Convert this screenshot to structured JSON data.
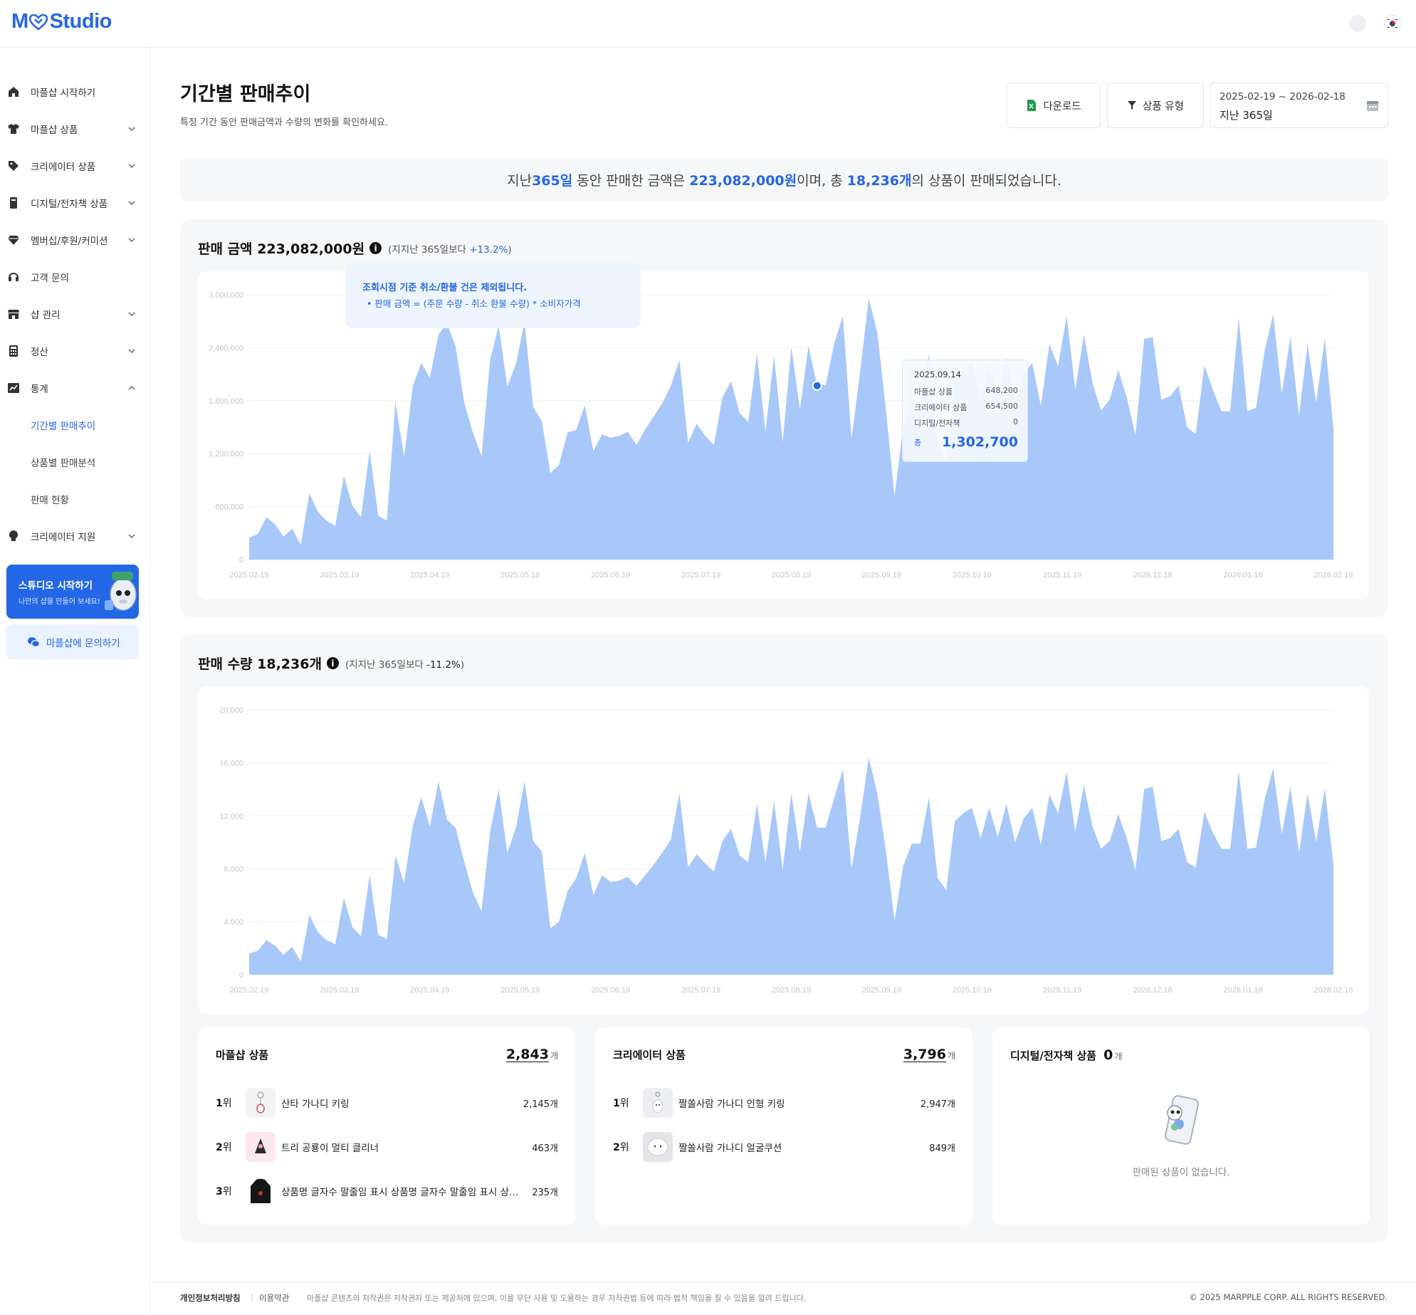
{
  "app": {
    "logo_prefix": "M",
    "logo_suffix": "Studio"
  },
  "sidebar": {
    "items": [
      {
        "label": "마플샵 시작하기",
        "icon": "home-icon"
      },
      {
        "label": "마플샵 상품",
        "icon": "tshirt-icon"
      },
      {
        "label": "크리에이터 상품",
        "icon": "tag-icon"
      },
      {
        "label": "디지털/전자책 상품",
        "icon": "book-icon"
      },
      {
        "label": "멤버십/후원/커미션",
        "icon": "diamond-icon"
      },
      {
        "label": "고객 문의",
        "icon": "headset-icon"
      },
      {
        "label": "샵 관리",
        "icon": "store-icon"
      },
      {
        "label": "정산",
        "icon": "calculator-icon"
      },
      {
        "label": "통계",
        "icon": "chart-icon"
      },
      {
        "label": "크리에이터 지원",
        "icon": "lightbulb-icon"
      }
    ],
    "stats_sub": [
      {
        "label": "기간별 판매추이",
        "active": true
      },
      {
        "label": "상품별 판매분석",
        "active": false
      },
      {
        "label": "판매 현황",
        "active": false
      }
    ],
    "promo_title": "스튜디오 시작하기",
    "promo_sub": "나만의 샵을 만들어 보세요!",
    "inquiry_label": "마플샵에 문의하기"
  },
  "header": {
    "title": "기간별 판매추이",
    "description": "특정 기간 동안 판매금액과 수량의 변화를 확인하세요.",
    "download_label": "다운로드",
    "type_label": "상품 유형",
    "date_range": "2025-02-19 ~ 2026-02-18",
    "date_label": "지난 365일"
  },
  "summary": {
    "p1": "지난 ",
    "days": "365일",
    "p2": " 동안 판매한 금액은 ",
    "amount": "223,082,000원",
    "p3": "이며, 총 ",
    "count": "18,236개",
    "p4": "의 상품이 판매되었습니다."
  },
  "amount_panel": {
    "title": "판매 금액 223,082,000원",
    "compare_prefix": "(지지난 365일보다 ",
    "compare_value": "+13.2%",
    "compare_suffix": ")",
    "notice_title": "조회시점 기준 취소/환불 건은 제외됩니다.",
    "notice_line": "•  판매 금액 = (주문 수량 - 취소 환불 수량) * 소비자가격"
  },
  "tooltip": {
    "date": "2025.09.14",
    "rows": [
      {
        "label": "마플샵 상품",
        "value": "648,200"
      },
      {
        "label": "크리에이터 상품",
        "value": "654,500"
      },
      {
        "label": "디지털/전자책",
        "value": "0"
      }
    ],
    "total_label": "총",
    "total_value": "1,302,700"
  },
  "qty_panel": {
    "title": "판매 수량 18,236개",
    "compare_prefix": "(지지난 365일보다 ",
    "compare_value": "-11.2%",
    "compare_suffix": ")"
  },
  "chart_data": [
    {
      "type": "area",
      "title": "판매 금액 223,082,000원",
      "x_ticks": [
        "2025.02.19",
        "2025.03.19",
        "2025.04.19",
        "2025.05.19",
        "2025.06.19",
        "2025.07.19",
        "2025.08.19",
        "2025.09.19",
        "2025.10.19",
        "2025.11.19",
        "2026.12.18",
        "2026.01.18",
        "2026.02.18"
      ],
      "y_ticks": [
        "3,000,000",
        "2,400,000",
        "1,800,000",
        "1,200,000",
        "600,000",
        "0"
      ],
      "ylim": [
        0,
        3000000
      ],
      "grid": true,
      "color": "#a8c8fa",
      "values": [
        250000,
        290000,
        480000,
        400000,
        260000,
        350000,
        170000,
        750000,
        540000,
        440000,
        380000,
        950000,
        610000,
        480000,
        1230000,
        500000,
        440000,
        1790000,
        1160000,
        1960000,
        2230000,
        2060000,
        2550000,
        2680000,
        2410000,
        1770000,
        1440000,
        1170000,
        2260000,
        2650000,
        1960000,
        2220000,
        2690000,
        1730000,
        1570000,
        980000,
        1070000,
        1440000,
        1470000,
        1750000,
        1230000,
        1420000,
        1380000,
        1400000,
        1450000,
        1300000,
        1470000,
        1620000,
        1770000,
        1970000,
        2260000,
        1320000,
        1540000,
        1400000,
        1300000,
        1840000,
        2020000,
        1660000,
        1560000,
        2330000,
        1450000,
        2310000,
        1330000,
        2410000,
        1700000,
        2420000,
        1970000,
        1980000,
        2450000,
        2760000,
        1370000,
        2130000,
        2960000,
        2570000,
        1690000,
        720000,
        1500000,
        1800000,
        1800000,
        2330000,
        1300000,
        1110000,
        2040000,
        2150000,
        2230000,
        1840000,
        2230000,
        1850000,
        2290000,
        1800000,
        2100000,
        2230000,
        1740000,
        2440000,
        2190000,
        2760000,
        1920000,
        2550000,
        2000000,
        1690000,
        1810000,
        2150000,
        1830000,
        1410000,
        2500000,
        2520000,
        1810000,
        1850000,
        1970000,
        1500000,
        1420000,
        2200000,
        1920000,
        1680000,
        1680000,
        2740000,
        1680000,
        1720000,
        2360000,
        2780000,
        1880000,
        2520000,
        1630000,
        2440000,
        1780000,
        2510000,
        1480000
      ],
      "highlight": {
        "date": "2025.09.14",
        "value": 1302700
      }
    },
    {
      "type": "area",
      "title": "판매 수량 18,236개",
      "x_ticks": [
        "2025.02.19",
        "2025.03.19",
        "2025.04.19",
        "2025.05.19",
        "2025.06.19",
        "2025.07.19",
        "2025.08.19",
        "2025.09.19",
        "2025.10.19",
        "2025.11.19",
        "2026.12.18",
        "2026.01.18",
        "2026.02.18"
      ],
      "y_ticks": [
        "20,000",
        "16,000",
        "12,000",
        "8,000",
        "4,000",
        "0"
      ],
      "ylim": [
        0,
        20000
      ],
      "grid": true,
      "color": "#a8c8fa",
      "values": [
        1600000,
        1800000,
        2600000,
        2200000,
        1500000,
        2100000,
        1000000,
        4500000,
        3200000,
        2600000,
        2300000,
        5800000,
        3600000,
        2900000,
        7500000,
        3000000,
        2700000,
        9000000,
        6900000,
        11200000,
        13400000,
        11200000,
        14600000,
        11700000,
        11100000,
        8500000,
        6200000,
        4800000,
        10800000,
        14000000,
        9200000,
        11100000,
        14600000,
        10100000,
        9300000,
        3500000,
        4000000,
        6300000,
        7300000,
        9200000,
        6000000,
        7500000,
        7000000,
        7100000,
        7400000,
        6700000,
        7500000,
        8300000,
        9200000,
        10200000,
        13700000,
        8100000,
        9100000,
        8400000,
        7800000,
        10100000,
        11000000,
        9000000,
        8500000,
        12900000,
        8500000,
        13100000,
        7900000,
        13700000,
        9300000,
        13700000,
        11100000,
        11100000,
        13400000,
        15500000,
        8000000,
        11900000,
        16400000,
        13700000,
        9300000,
        4100000,
        8200000,
        9900000,
        9900000,
        13400000,
        7300000,
        6400000,
        11600000,
        12200000,
        12600000,
        10300000,
        12600000,
        10400000,
        12900000,
        10000000,
        11800000,
        12600000,
        9800000,
        13600000,
        12200000,
        15300000,
        10800000,
        14300000,
        11200000,
        9500000,
        10100000,
        12100000,
        10300000,
        7900000,
        14000000,
        14200000,
        10100000,
        10300000,
        11000000,
        8500000,
        8100000,
        12300000,
        10700000,
        9500000,
        9500000,
        15400000,
        9500000,
        9600000,
        13200000,
        15600000,
        10600000,
        14200000,
        9200000,
        13700000,
        10000000,
        14100000,
        8300000
      ],
      "note": "values above are unitless placeholder magnitudes for the quantity series"
    }
  ],
  "rankings": {
    "marpple": {
      "title": "마플샵 상품",
      "total": "2,843",
      "unit": "개",
      "items": [
        {
          "rank": "1",
          "rank_suffix": "위",
          "name": "산타 가나디 키링",
          "count": "2,145개"
        },
        {
          "rank": "2",
          "rank_suffix": "위",
          "name": "트리 공룡이 멀티 클리너",
          "count": "463개"
        },
        {
          "rank": "3",
          "rank_suffix": "위",
          "name": "상품명 글자수 말줄임 표시 상품명 글자수 말줄임 표시 상품명",
          "count": "235개"
        }
      ]
    },
    "creator": {
      "title": "크리에이터 상품",
      "total": "3,796",
      "unit": "개",
      "items": [
        {
          "rank": "1",
          "rank_suffix": "위",
          "name": "짤쏠사람 가나디 인형 키링",
          "count": "2,947개"
        },
        {
          "rank": "2",
          "rank_suffix": "위",
          "name": "짤쏠사람 가나디 얼굴쿠션",
          "count": "849개"
        }
      ]
    },
    "digital": {
      "title": "디지털/전자책 상품",
      "total": "0",
      "unit": "개",
      "empty_text": "판매된 상품이 없습니다."
    }
  },
  "footer": {
    "privacy": "개인정보처리방침",
    "separator": "|",
    "terms": "이용약관",
    "notice": "마플샵 콘텐츠의 저작권은 저작권자 또는 제공처에 있으며, 이를 무단 사용 및 도용하는 경우 저작권법 등에 따라 법적 책임을 질 수 있음을 알려 드립니다.",
    "copyright": "© 2025 MARPPLE CORP. ALL RIGHTS RESERVED."
  },
  "colors": {
    "accent": "#2467e6",
    "chart_fill": "#a8c8fa",
    "panel_bg": "#f6f7f9"
  }
}
